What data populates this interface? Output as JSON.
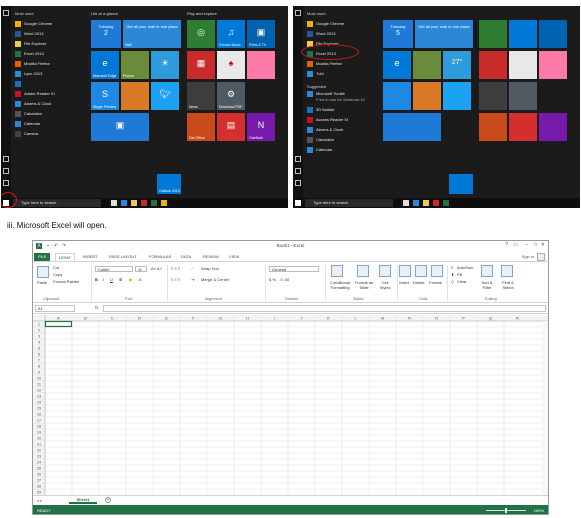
{
  "left_start": {
    "most_used_heading": "Most used",
    "apps": [
      {
        "label": "Google Chrome",
        "color": "#f0b400"
      },
      {
        "label": "Word 2013",
        "color": "#2b5797"
      },
      {
        "label": "File Explorer",
        "color": "#f2c94c"
      },
      {
        "label": "Excel 2013",
        "color": "#217346"
      },
      {
        "label": "Mozilla Firefox",
        "color": "#e66000"
      },
      {
        "label": "Lync 2013",
        "color": "#1e90d8"
      },
      {
        "label": "",
        "color": "#1f6fb5"
      },
      {
        "label": "Adobe Reader XI",
        "color": "#c8102e"
      },
      {
        "label": "Alarms & Clock",
        "color": "#2b88d8"
      },
      {
        "label": "Calculator",
        "color": "#555555"
      },
      {
        "label": "Calendar",
        "color": "#2b88d8"
      },
      {
        "label": "Camera",
        "color": "#444444"
      }
    ],
    "group1_title": "Life at a glance",
    "group2_title": "Play and explore",
    "tiles": {
      "calendar_day": "Tuesday",
      "calendar_date": "2",
      "calendar_label": "Calendar",
      "mail_text": "Get all your mail in one place",
      "mail_label": "Mail",
      "edge_label": "Microsoft Edge",
      "photos_label": "Photos",
      "weather_label": "Weather",
      "xbox_label": "Xbox",
      "groove_label": "Groove Music",
      "films_label": "Films & TV",
      "store_label": "Store",
      "skype_label": "Skype Preview",
      "twitter_label": "Twitter",
      "download_label": "Download PDF",
      "office_label": "Get Office",
      "onenote_label": "OneNote",
      "news_label": "News",
      "outlook_label": "Outlook 2013"
    },
    "search_placeholder": "Type here to search"
  },
  "right_start": {
    "most_used_heading": "Most used",
    "apps": [
      {
        "label": "Google Chrome",
        "color": "#f0b400"
      },
      {
        "label": "Word 2013",
        "color": "#2b5797"
      },
      {
        "label": "File Explorer",
        "color": "#f2c94c"
      },
      {
        "label": "Excel 2013",
        "color": "#217346"
      },
      {
        "label": "Mozilla Firefox",
        "color": "#e66000"
      },
      {
        "label": "Tubi",
        "color": "#1e90d8"
      }
    ],
    "suggested_heading": "Suggested",
    "suggested_app": "Microsoft Toolkit",
    "suggested_sub": "Free to use for Windows 10",
    "apps2": [
      {
        "label": "3D Builder",
        "color": "#1f6fb5"
      },
      {
        "label": "Access Reader XI",
        "color": "#c8102e"
      },
      {
        "label": "Alarms & Clock",
        "color": "#2b88d8"
      },
      {
        "label": "Calculator",
        "color": "#555555"
      },
      {
        "label": "Calendar",
        "color": "#2b88d8"
      }
    ],
    "tiles": {
      "calendar_day": "Tuesday",
      "calendar_date": "5",
      "temp": "27°",
      "mail_text": "Get all your mail in one place"
    },
    "search_placeholder": "Type here to search"
  },
  "caption": "iii. Microsoft Excel will open.",
  "excel": {
    "title": "Book1 - Excel",
    "tabs": [
      "FILE",
      "HOME",
      "INSERT",
      "PAGE LAYOUT",
      "FORMULAS",
      "DATA",
      "REVIEW",
      "VIEW"
    ],
    "sign_in": "Sign in",
    "ribbon": {
      "cut": "Cut",
      "copy": "Copy",
      "paste": "Paste",
      "format_painter": "Format Painter",
      "clipboard": "Clipboard",
      "font_name": "Calibri",
      "font_size": "11",
      "font": "Font",
      "wrap_text": "Wrap Text",
      "merge_center": "Merge & Center",
      "alignment": "Alignment",
      "number_format": "General",
      "number": "Number",
      "conditional": "Conditional Formatting",
      "format_as_table": "Format as Table",
      "cell_styles": "Cell Styles",
      "styles": "Styles",
      "insert": "Insert",
      "delete": "Delete",
      "format": "Format",
      "cells": "Cells",
      "autosum": "AutoSum",
      "fill": "Fill",
      "clear": "Clear",
      "sort_filter": "Sort & Filter",
      "find_select": "Find & Select",
      "editing": "Editing"
    },
    "name_box": "A1",
    "fx": "fx",
    "columns": [
      "A",
      "B",
      "C",
      "D",
      "E",
      "F",
      "G",
      "H",
      "I",
      "J",
      "K",
      "L",
      "M",
      "N",
      "O",
      "P",
      "Q",
      "R"
    ],
    "row_count": 29,
    "sheet_tab": "Sheet1",
    "status": "READY",
    "zoom": "100%",
    "accent": "#217346"
  }
}
